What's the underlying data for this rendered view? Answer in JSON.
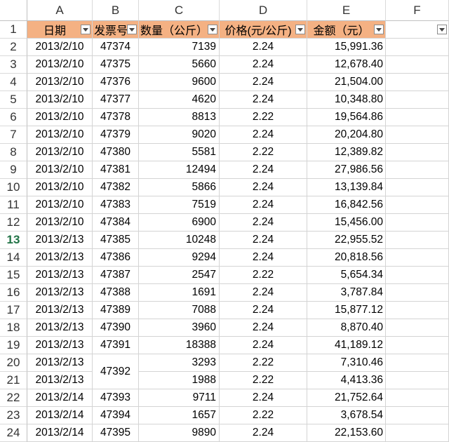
{
  "columns": [
    "A",
    "B",
    "C",
    "D",
    "E",
    "F"
  ],
  "headers": {
    "date": "日期",
    "invoice": "发票号",
    "qty": "数量（公斤）",
    "price": "价格(元/公斤)",
    "amount": "金额（元）"
  },
  "row_numbers": [
    "1",
    "2",
    "3",
    "4",
    "5",
    "6",
    "7",
    "8",
    "9",
    "10",
    "11",
    "12",
    "13",
    "14",
    "15",
    "16",
    "17",
    "18",
    "19",
    "20",
    "21",
    "22",
    "23",
    "24"
  ],
  "active_row": "13",
  "rows": [
    {
      "date": "2013/2/10",
      "invoice": "47374",
      "qty": "7139",
      "price": "2.24",
      "amount": "15,991.36"
    },
    {
      "date": "2013/2/10",
      "invoice": "47375",
      "qty": "5660",
      "price": "2.24",
      "amount": "12,678.40"
    },
    {
      "date": "2013/2/10",
      "invoice": "47376",
      "qty": "9600",
      "price": "2.24",
      "amount": "21,504.00"
    },
    {
      "date": "2013/2/10",
      "invoice": "47377",
      "qty": "4620",
      "price": "2.24",
      "amount": "10,348.80"
    },
    {
      "date": "2013/2/10",
      "invoice": "47378",
      "qty": "8813",
      "price": "2.22",
      "amount": "19,564.86"
    },
    {
      "date": "2013/2/10",
      "invoice": "47379",
      "qty": "9020",
      "price": "2.24",
      "amount": "20,204.80"
    },
    {
      "date": "2013/2/10",
      "invoice": "47380",
      "qty": "5581",
      "price": "2.22",
      "amount": "12,389.82"
    },
    {
      "date": "2013/2/10",
      "invoice": "47381",
      "qty": "12494",
      "price": "2.24",
      "amount": "27,986.56"
    },
    {
      "date": "2013/2/10",
      "invoice": "47382",
      "qty": "5866",
      "price": "2.24",
      "amount": "13,139.84"
    },
    {
      "date": "2013/2/10",
      "invoice": "47383",
      "qty": "7519",
      "price": "2.24",
      "amount": "16,842.56"
    },
    {
      "date": "2013/2/10",
      "invoice": "47384",
      "qty": "6900",
      "price": "2.24",
      "amount": "15,456.00"
    },
    {
      "date": "2013/2/13",
      "invoice": "47385",
      "qty": "10248",
      "price": "2.24",
      "amount": "22,955.52"
    },
    {
      "date": "2013/2/13",
      "invoice": "47386",
      "qty": "9294",
      "price": "2.24",
      "amount": "20,818.56"
    },
    {
      "date": "2013/2/13",
      "invoice": "47387",
      "qty": "2547",
      "price": "2.22",
      "amount": "5,654.34"
    },
    {
      "date": "2013/2/13",
      "invoice": "47388",
      "qty": "1691",
      "price": "2.24",
      "amount": "3,787.84"
    },
    {
      "date": "2013/2/13",
      "invoice": "47389",
      "qty": "7088",
      "price": "2.24",
      "amount": "15,877.12"
    },
    {
      "date": "2013/2/13",
      "invoice": "47390",
      "qty": "3960",
      "price": "2.24",
      "amount": "8,870.40"
    },
    {
      "date": "2013/2/13",
      "invoice": "47391",
      "qty": "18388",
      "price": "2.24",
      "amount": "41,189.12"
    },
    {
      "date": "2013/2/13",
      "invoice": "47392",
      "qty": "3293",
      "price": "2.22",
      "amount": "7,310.46",
      "merge_invoice_down": true
    },
    {
      "date": "2013/2/13",
      "invoice": "",
      "qty": "1988",
      "price": "2.22",
      "amount": "4,413.36",
      "merged_invoice": true
    },
    {
      "date": "2013/2/14",
      "invoice": "47393",
      "qty": "9711",
      "price": "2.24",
      "amount": "21,752.64"
    },
    {
      "date": "2013/2/14",
      "invoice": "47394",
      "qty": "1657",
      "price": "2.22",
      "amount": "3,678.54"
    },
    {
      "date": "2013/2/14",
      "invoice": "47395",
      "qty": "9890",
      "price": "2.24",
      "amount": "22,153.60"
    }
  ]
}
